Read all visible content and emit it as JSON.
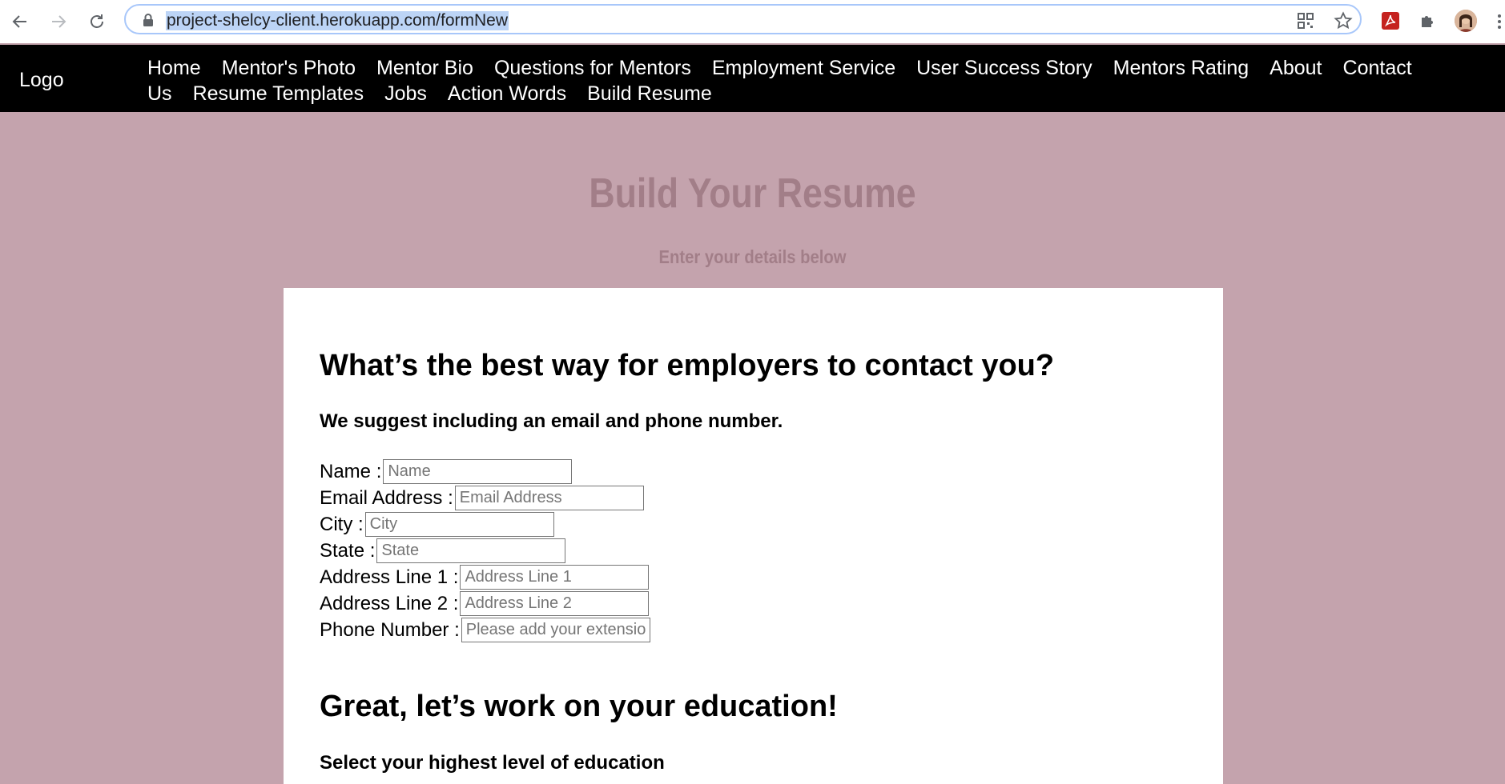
{
  "browser": {
    "url": "project-shelcy-client.herokuapp.com/formNew"
  },
  "site_nav": {
    "logo": "Logo",
    "links": [
      "Home",
      "Mentor's Photo",
      "Mentor Bio",
      "Questions for Mentors",
      "Employment Service",
      "User Success Story",
      "Mentors Rating",
      "About",
      "Contact Us",
      "Resume Templates",
      "Jobs",
      "Action Words",
      "Build Resume"
    ]
  },
  "hero": {
    "title": "Build Your Resume",
    "subtitle": "Enter your details below"
  },
  "contact_section": {
    "heading": "What’s the best way for employers to contact you?",
    "subheading": "We suggest including an email and phone number.",
    "fields": [
      {
        "label": "Name :",
        "placeholder": "Name",
        "value": ""
      },
      {
        "label": "Email Address :",
        "placeholder": "Email Address",
        "value": ""
      },
      {
        "label": "City :",
        "placeholder": "City",
        "value": ""
      },
      {
        "label": "State :",
        "placeholder": "State",
        "value": ""
      },
      {
        "label": "Address Line 1 :",
        "placeholder": "Address Line 1",
        "value": ""
      },
      {
        "label": "Address Line 2 :",
        "placeholder": "Address Line 2",
        "value": ""
      },
      {
        "label": "Phone Number :",
        "placeholder": "Please add your extension",
        "value": ""
      }
    ]
  },
  "education_section": {
    "heading": "Great, let’s work on your education!",
    "subheading": "Select your highest level of education"
  }
}
